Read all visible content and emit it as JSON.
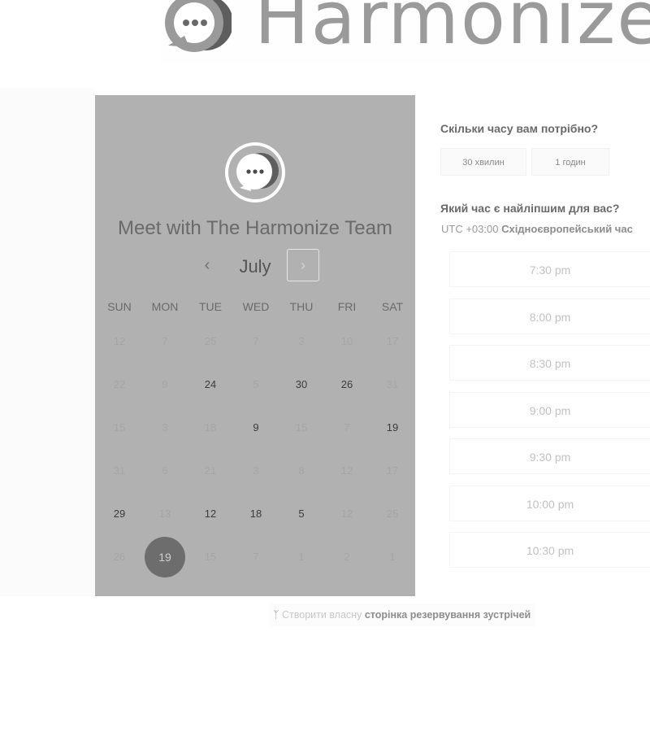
{
  "brand": {
    "name": "Harmonize"
  },
  "host": {
    "title": "Meet with The Harmonize Team"
  },
  "calendar": {
    "month": "July",
    "prev_icon": "chevron-left-icon",
    "next_icon": "chevron-right-icon",
    "weekdays": [
      "SUN",
      "MON",
      "TUE",
      "WED",
      "THU",
      "FRI",
      "SAT"
    ],
    "weeks": [
      [
        {
          "d": "12",
          "on": false
        },
        {
          "d": "7",
          "on": false
        },
        {
          "d": "25",
          "on": false
        },
        {
          "d": "7",
          "on": false
        },
        {
          "d": "3",
          "on": false
        },
        {
          "d": "10",
          "on": false
        },
        {
          "d": "17",
          "on": false
        }
      ],
      [
        {
          "d": "22",
          "on": false
        },
        {
          "d": "9",
          "on": false
        },
        {
          "d": "24",
          "on": true
        },
        {
          "d": "5",
          "on": false
        },
        {
          "d": "30",
          "on": true
        },
        {
          "d": "26",
          "on": true
        },
        {
          "d": "31",
          "on": false
        }
      ],
      [
        {
          "d": "15",
          "on": false
        },
        {
          "d": "3",
          "on": false
        },
        {
          "d": "18",
          "on": false
        },
        {
          "d": "9",
          "on": true
        },
        {
          "d": "15",
          "on": false
        },
        {
          "d": "7",
          "on": false
        },
        {
          "d": "19",
          "on": true
        }
      ],
      [
        {
          "d": "31",
          "on": false
        },
        {
          "d": "6",
          "on": false
        },
        {
          "d": "21",
          "on": false
        },
        {
          "d": "3",
          "on": false
        },
        {
          "d": "8",
          "on": false
        },
        {
          "d": "12",
          "on": false
        },
        {
          "d": "17",
          "on": false
        }
      ],
      [
        {
          "d": "29",
          "on": true
        },
        {
          "d": "13",
          "on": false
        },
        {
          "d": "12",
          "on": true
        },
        {
          "d": "18",
          "on": true
        },
        {
          "d": "5",
          "on": true
        },
        {
          "d": "12",
          "on": false
        },
        {
          "d": "25",
          "on": false
        }
      ],
      [
        {
          "d": "26",
          "on": false
        },
        {
          "d": "19",
          "on": true,
          "selected": true
        },
        {
          "d": "15",
          "on": false
        },
        {
          "d": "7",
          "on": false
        },
        {
          "d": "1",
          "on": false
        },
        {
          "d": "2",
          "on": false
        },
        {
          "d": "1",
          "on": false
        }
      ]
    ]
  },
  "booking": {
    "duration_question": "Скільки часу вам потрібно?",
    "durations": [
      "30 хвилин",
      "1 годин"
    ],
    "time_question": "Який час є найліпшим для вас?",
    "tz_offset": "UTC +03:00",
    "tz_name": "Східноєвропейський час",
    "slots": [
      "7:30 pm",
      "8:00 pm",
      "8:30 pm",
      "9:00 pm",
      "9:30 pm",
      "10:00 pm",
      "10:30 pm"
    ]
  },
  "footer": {
    "icon": "hubspot-sprocket-icon",
    "prefix": "Створити власну",
    "link": "сторінка резервування зустрічей"
  },
  "colors": {
    "panel": "#b1b1b1",
    "selected_day": "#6d6d6d"
  }
}
